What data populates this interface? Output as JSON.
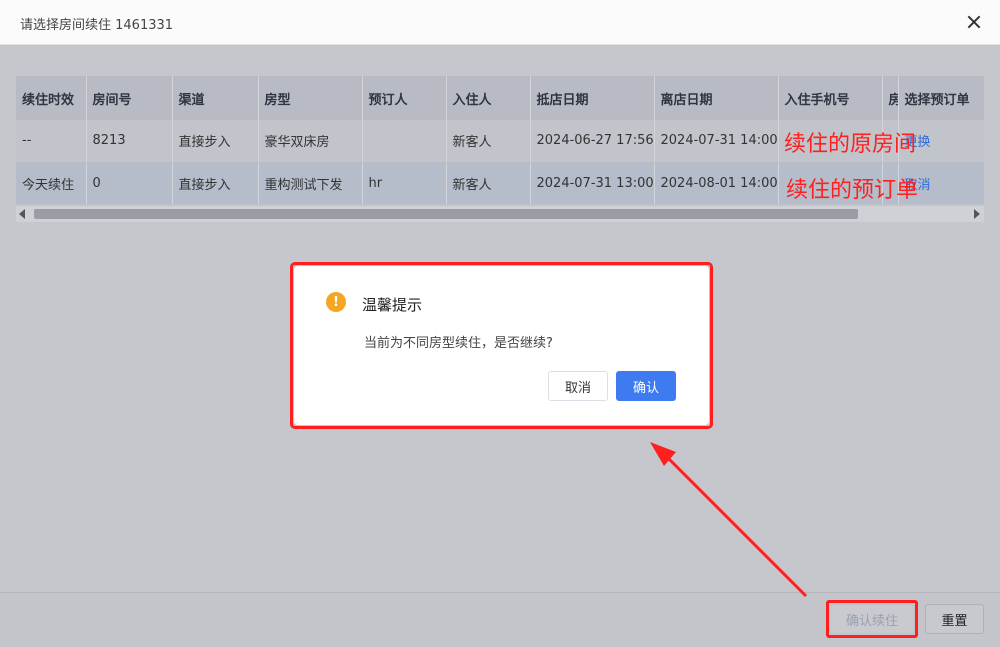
{
  "dialog": {
    "title": "请选择房间续住 1461331"
  },
  "table": {
    "columns": [
      "续住时效",
      "房间号",
      "渠道",
      "房型",
      "预订人",
      "入住人",
      "抵店日期",
      "离店日期",
      "入住手机号",
      "房",
      "选择预订单"
    ],
    "rows": [
      [
        "--",
        "8213",
        "直接步入",
        "豪华双床房",
        "",
        "新客人",
        "2024-06-27 17:56",
        "2024-07-31 14:00",
        "",
        "",
        "更换"
      ],
      [
        "今天续住",
        "0",
        "直接步入",
        "重构测试下发",
        "hr",
        "新客人",
        "2024-07-31 13:00",
        "2024-08-01 14:00",
        "",
        "",
        "取消"
      ]
    ]
  },
  "annotations": {
    "original_room": "续住的原房间",
    "booking": "续住的预订单"
  },
  "footer": {
    "confirm_label": "确认续住",
    "reset_label": "重置"
  },
  "message_box": {
    "icon": "warning-icon",
    "icon_glyph": "!",
    "title": "温馨提示",
    "message": "当前为不同房型续住，是否继续?",
    "cancel_label": "取消",
    "ok_label": "确认"
  },
  "colors": {
    "annotation_red": "#ff1f1f",
    "primary_blue": "#3f7bf0",
    "warning_orange": "#f5a623",
    "link_blue": "#2f6ad8"
  }
}
